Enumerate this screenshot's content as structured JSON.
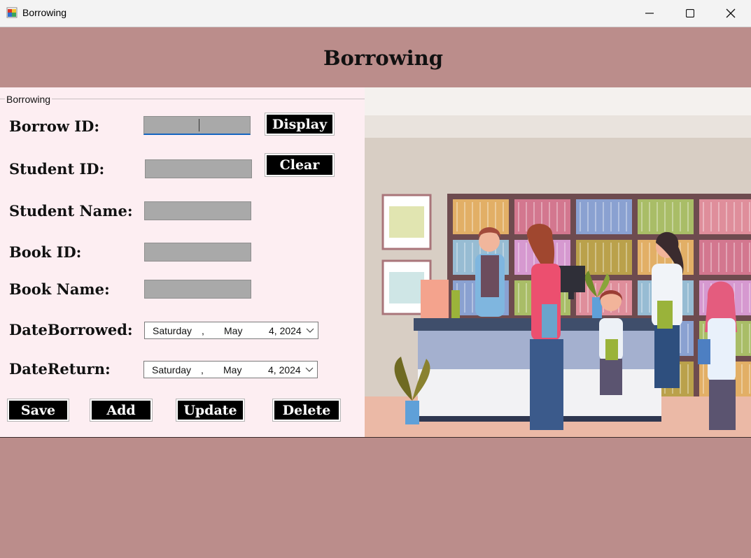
{
  "window": {
    "title": "Borrowing",
    "controls": [
      "minimize",
      "maximize",
      "close"
    ]
  },
  "header": {
    "title": "Borrowing"
  },
  "group": {
    "caption": "Borrowing"
  },
  "form": {
    "borrow_id": {
      "label": "Borrow ID:",
      "value": ""
    },
    "student_id": {
      "label": "Student ID:",
      "value": ""
    },
    "student_name": {
      "label": "Student Name:",
      "value": ""
    },
    "book_id": {
      "label": "Book ID:",
      "value": ""
    },
    "book_name": {
      "label": "Book Name:",
      "value": ""
    },
    "date_borrowed": {
      "label": "DateBorrowed:",
      "weekday": "Saturday",
      "sep": ",",
      "month": "May",
      "day_year": "4, 2024"
    },
    "date_return": {
      "label": "DateReturn:",
      "weekday": "Saturday",
      "sep": ",",
      "month": "May",
      "day_year": "4, 2024"
    }
  },
  "buttons": {
    "display": "Display",
    "clear": "Clear",
    "save": "Save",
    "add": "Add",
    "update": "Update",
    "delete": "Delete"
  },
  "colors": {
    "header_bg": "#bb8d8b",
    "panel_bg": "#fdeef2",
    "textbox_bg": "#a9a9a9",
    "button_bg": "#000000",
    "button_text": "#ffffff"
  },
  "illustration": {
    "subject": "library-checkout-illustration"
  }
}
